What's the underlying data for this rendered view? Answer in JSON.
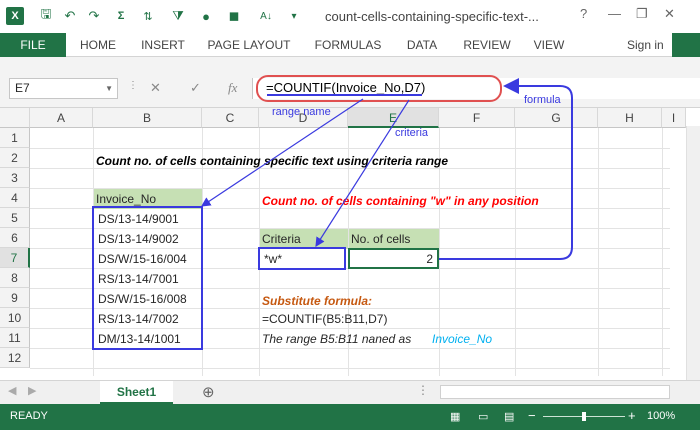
{
  "window": {
    "app_icon": "X",
    "title": "count-cells-containing-specific-text-...",
    "controls": [
      "?",
      "—",
      "❐",
      "✕"
    ]
  },
  "ribbon": {
    "tabs": [
      "FILE",
      "HOME",
      "INSERT",
      "PAGE LAYOUT",
      "FORMULAS",
      "DATA",
      "REVIEW",
      "VIEW"
    ],
    "sign_in": "Sign in"
  },
  "formula_bar": {
    "name_box": "E7",
    "fx": "fx",
    "formula": "=COUNTIF(Invoice_No,D7)"
  },
  "columns": [
    "A",
    "B",
    "C",
    "D",
    "E",
    "F",
    "G",
    "H",
    "I"
  ],
  "selected_column": "E",
  "rows": [
    "1",
    "2",
    "3",
    "4",
    "5",
    "6",
    "7",
    "8",
    "9",
    "10",
    "11",
    "12"
  ],
  "selected_row": "7",
  "sheet": {
    "heading": "Count no. of cells  containing specific text using criteria range",
    "list_header": "Invoice_No",
    "invoices": [
      "DS/13-14/9001",
      "DS/13-14/9002",
      "DS/W/15-16/004",
      "RS/13-14/7001",
      "DS/W/15-16/008",
      "RS/13-14/7002",
      "DM/13-14/1001"
    ],
    "count_title": "Count no. of cells containing \"w\" in any position",
    "criteria_header": "Criteria",
    "result_header": "No. of cells",
    "criteria_value": "*w*",
    "result_value": "2",
    "substitute_label": "Substitute formula:",
    "substitute_formula": "=COUNTIF(B5:B11,D7)",
    "range_note": "The range B5:B11 naned as",
    "range_name": "Invoice_No"
  },
  "annotations": {
    "range_name": "range name",
    "criteria": "criteria",
    "formula": "formula"
  },
  "sheet_tabs": {
    "active": "Sheet1",
    "add": "⊕"
  },
  "status": {
    "text": "READY",
    "zoom": "100%"
  },
  "colors": {
    "excel_green": "#217346",
    "header_fill": "#c6e0b4",
    "callout_blue": "#3a3adf",
    "heading_red": "#ff0000",
    "substitute_orange": "#c65911",
    "range_name_cyan": "#00b0f0"
  }
}
